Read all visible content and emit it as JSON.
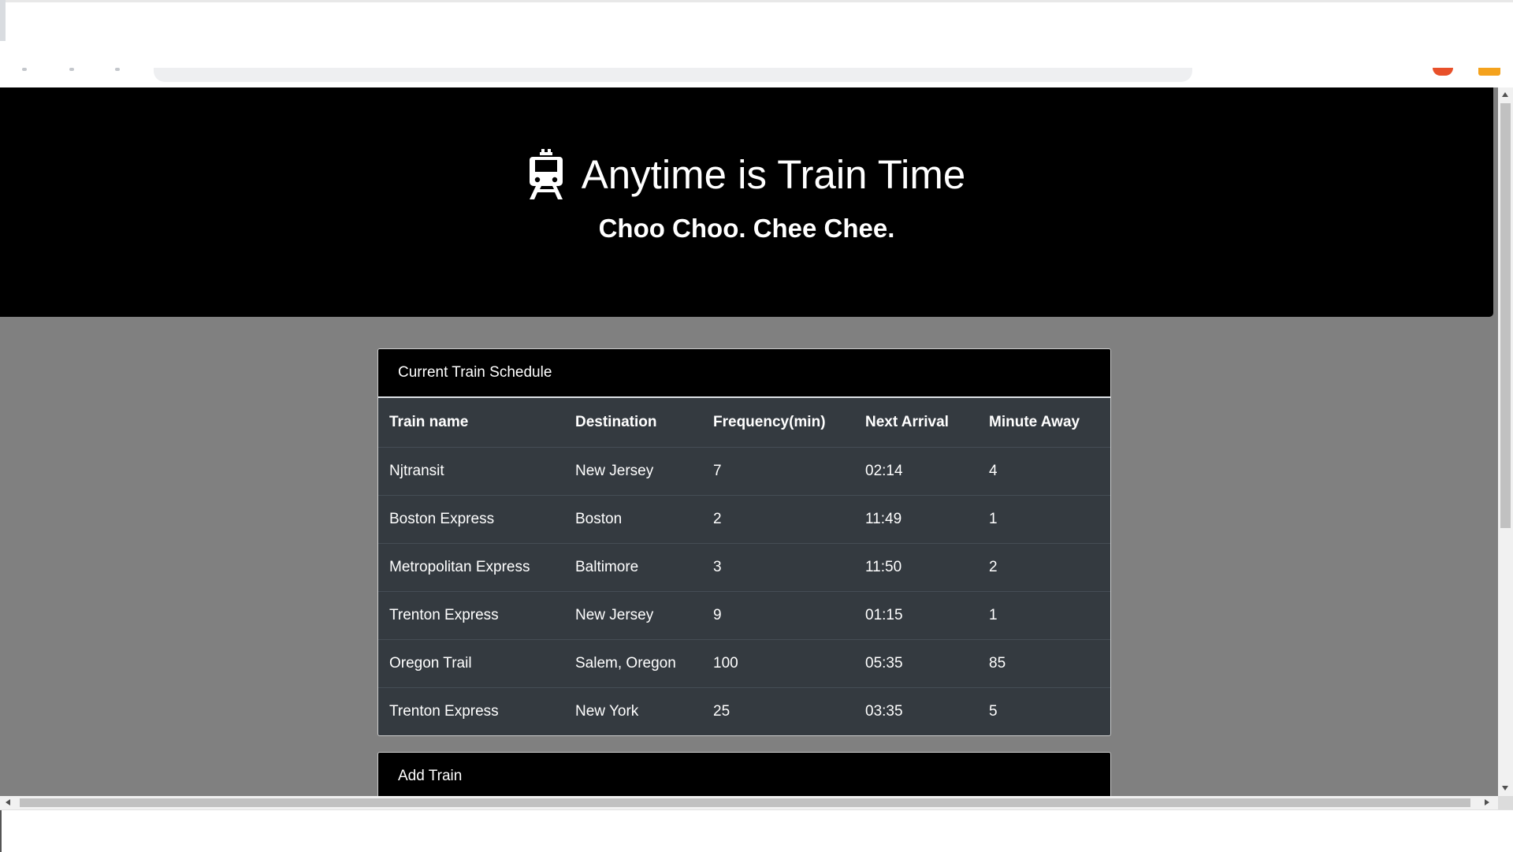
{
  "colors": {
    "hero_background": "#000000",
    "page_background": "#808080",
    "table_background": "#343a40",
    "card_header_background": "#000000",
    "text": "#ffffff"
  },
  "hero": {
    "icon": "train-icon",
    "title": "Anytime is Train Time",
    "subtitle": "Choo Choo. Chee Chee."
  },
  "schedule": {
    "header": "Current Train Schedule",
    "columns": [
      "Train name",
      "Destination",
      "Frequency(min)",
      "Next Arrival",
      "Minute Away"
    ],
    "rows": [
      [
        "Njtransit",
        "New Jersey",
        "7",
        "02:14",
        "4"
      ],
      [
        "Boston Express",
        "Boston",
        "2",
        "11:49",
        "1"
      ],
      [
        "Metropolitan Express",
        "Baltimore",
        "3",
        "11:50",
        "2"
      ],
      [
        "Trenton Express",
        "New Jersey",
        "9",
        "01:15",
        "1"
      ],
      [
        "Oregon Trail",
        "Salem, Oregon",
        "100",
        "05:35",
        "85"
      ],
      [
        "Trenton Express",
        "New York",
        "25",
        "03:35",
        "5"
      ]
    ]
  },
  "add_train": {
    "header": "Add Train"
  }
}
